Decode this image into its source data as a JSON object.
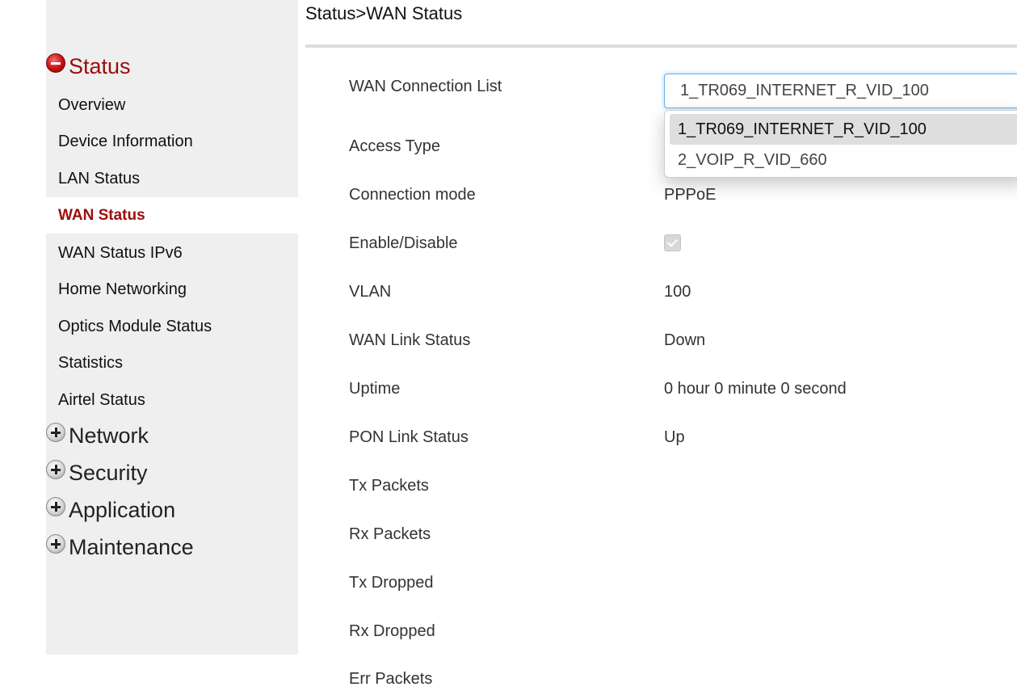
{
  "breadcrumb": "Status>WAN Status",
  "sidebar": {
    "status_group": "Status",
    "items": [
      {
        "label": "Overview"
      },
      {
        "label": "Device Information"
      },
      {
        "label": "LAN Status"
      },
      {
        "label": "WAN Status"
      },
      {
        "label": "WAN Status IPv6"
      },
      {
        "label": "Home Networking"
      },
      {
        "label": "Optics Module Status"
      },
      {
        "label": "Statistics"
      },
      {
        "label": "Airtel Status"
      }
    ],
    "groups": [
      {
        "label": "Network"
      },
      {
        "label": "Security"
      },
      {
        "label": "Application"
      },
      {
        "label": "Maintenance"
      }
    ]
  },
  "wan": {
    "connection_list_label": "WAN Connection List",
    "connection_selected": "1_TR069_INTERNET_R_VID_100",
    "connection_options": [
      "1_TR069_INTERNET_R_VID_100",
      "2_VOIP_R_VID_660"
    ],
    "rows": [
      {
        "label": "Access Type",
        "value": ""
      },
      {
        "label": "Connection mode",
        "value": "PPPoE"
      },
      {
        "label": "Enable/Disable",
        "value": ""
      },
      {
        "label": "VLAN",
        "value": "100"
      },
      {
        "label": "WAN Link Status",
        "value": "Down"
      },
      {
        "label": "Uptime",
        "value": "0 hour 0 minute 0 second"
      },
      {
        "label": "PON Link Status",
        "value": "Up"
      },
      {
        "label": "Tx Packets",
        "value": ""
      },
      {
        "label": "Rx Packets",
        "value": ""
      },
      {
        "label": "Tx Dropped",
        "value": ""
      },
      {
        "label": "Rx Dropped",
        "value": ""
      },
      {
        "label": "Err Packets",
        "value": ""
      }
    ],
    "enable_checked": true
  }
}
